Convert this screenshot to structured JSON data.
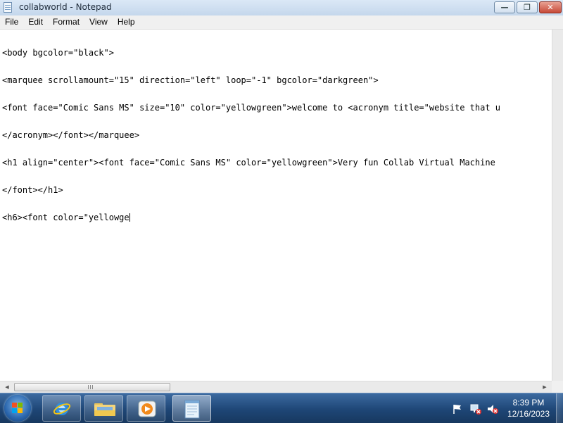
{
  "window": {
    "title": "collabworld - Notepad",
    "icon": "notepad-icon",
    "controls": {
      "minimize": "—",
      "maximize": "❐",
      "close": "✕"
    }
  },
  "menu": {
    "items": [
      "File",
      "Edit",
      "Format",
      "View",
      "Help"
    ]
  },
  "editor": {
    "lines": [
      "<body bgcolor=\"black\">",
      "<marquee scrollamount=\"15\" direction=\"left\" loop=\"-1\" bgcolor=\"darkgreen\">",
      "<font face=\"Comic Sans MS\" size=\"10\" color=\"yellowgreen\">welcome to <acronym title=\"website that u",
      "</acronym></font></marquee>",
      "<h1 align=\"center\"><font face=\"Comic Sans MS\" color=\"yellowgreen\">Very fun Collab Virtual Machine",
      "</font></h1>",
      "<h6><font color=\"yellowge"
    ]
  },
  "taskbar": {
    "apps": [
      {
        "name": "internet-explorer-icon",
        "active": false
      },
      {
        "name": "file-explorer-icon",
        "active": false
      },
      {
        "name": "media-player-icon",
        "active": false
      },
      {
        "name": "notepad-icon",
        "active": true
      }
    ],
    "tray_icons": [
      "action-center-flag-icon",
      "network-icon",
      "volume-muted-icon"
    ],
    "clock": {
      "time": "8:39 PM",
      "date": "12/16/2023"
    }
  },
  "colors": {
    "titlebar": "#c4d7ec",
    "taskbar": "#1e4676",
    "editor_bg": "#ffffff"
  }
}
